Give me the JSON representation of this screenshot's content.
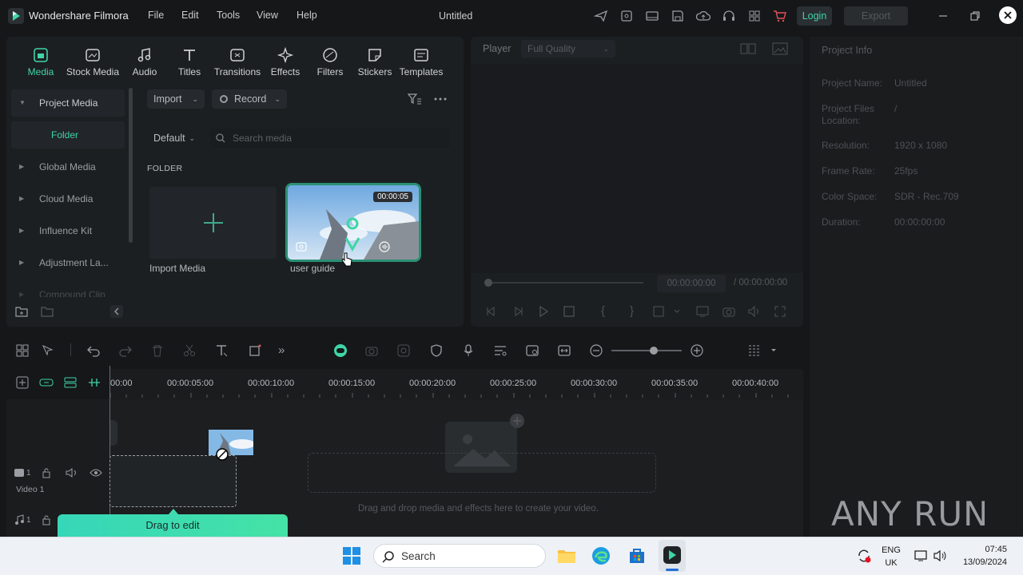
{
  "app": {
    "name": "Wondershare Filmora",
    "document_title": "Untitled"
  },
  "menu": [
    "File",
    "Edit",
    "Tools",
    "View",
    "Help"
  ],
  "titlebar": {
    "login_label": "Login",
    "export_label": "Export"
  },
  "categories": [
    "Media",
    "Stock Media",
    "Audio",
    "Titles",
    "Transitions",
    "Effects",
    "Filters",
    "Stickers",
    "Templates"
  ],
  "sidebar": {
    "items": [
      "Project Media",
      "Folder",
      "Global Media",
      "Cloud Media",
      "Influence Kit",
      "Adjustment La...",
      "Compound Clip"
    ]
  },
  "media_toolbar": {
    "import_label": "Import",
    "record_label": "Record",
    "sort_label": "Default",
    "search_placeholder": "Search media"
  },
  "folder_heading": "FOLDER",
  "media_items": [
    {
      "label": "Import Media"
    },
    {
      "label": "user guide",
      "duration": "00:00:05"
    }
  ],
  "player": {
    "label": "Player",
    "quality": "Full Quality",
    "current_time": "00:00:00:00",
    "total_time": "/ 00:00:00:00"
  },
  "project_info": {
    "title": "Project Info",
    "rows": [
      {
        "key": "Project Name:",
        "value": "Untitled"
      },
      {
        "key": "Project Files Location:",
        "value": "/"
      },
      {
        "key": "Resolution:",
        "value": "1920 x 1080"
      },
      {
        "key": "Frame Rate:",
        "value": "25fps"
      },
      {
        "key": "Color Space:",
        "value": "SDR - Rec.709"
      },
      {
        "key": "Duration:",
        "value": "00:00:00:00"
      }
    ]
  },
  "timeline": {
    "ticks": [
      "00:00",
      "00:00:05:00",
      "00:00:10:00",
      "00:00:15:00",
      "00:00:20:00",
      "00:00:25:00",
      "00:00:30:00",
      "00:00:35:00",
      "00:00:40:00"
    ],
    "video_track_label": "Video 1",
    "video_track_index": "1",
    "audio_track_index": "1",
    "drop_hint": "Drag and drop media and effects here to create your video.",
    "drag_tip": "Drag to edit"
  },
  "watermark": "ANY RUN",
  "taskbar": {
    "search_label": "Search",
    "lang_1": "ENG",
    "lang_2": "UK",
    "time": "07:45",
    "date": "13/09/2024"
  },
  "colors": {
    "accent": "#3fd5a5",
    "panel": "#1c1f22",
    "background": "#151719",
    "taskbar": "#eef1f6"
  }
}
